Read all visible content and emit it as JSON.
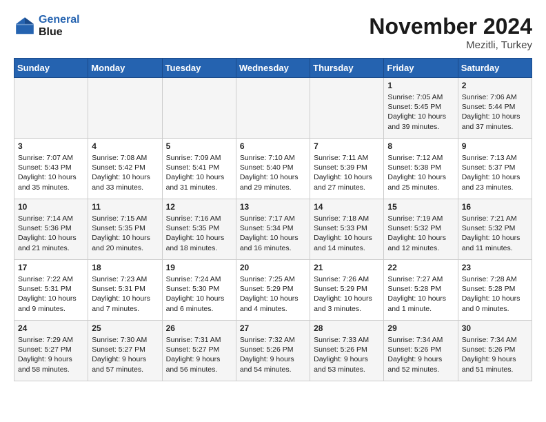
{
  "header": {
    "logo_line1": "General",
    "logo_line2": "Blue",
    "month": "November 2024",
    "location": "Mezitli, Turkey"
  },
  "days_of_week": [
    "Sunday",
    "Monday",
    "Tuesday",
    "Wednesday",
    "Thursday",
    "Friday",
    "Saturday"
  ],
  "weeks": [
    [
      {
        "day": "",
        "info": ""
      },
      {
        "day": "",
        "info": ""
      },
      {
        "day": "",
        "info": ""
      },
      {
        "day": "",
        "info": ""
      },
      {
        "day": "",
        "info": ""
      },
      {
        "day": "1",
        "info": "Sunrise: 7:05 AM\nSunset: 5:45 PM\nDaylight: 10 hours and 39 minutes."
      },
      {
        "day": "2",
        "info": "Sunrise: 7:06 AM\nSunset: 5:44 PM\nDaylight: 10 hours and 37 minutes."
      }
    ],
    [
      {
        "day": "3",
        "info": "Sunrise: 7:07 AM\nSunset: 5:43 PM\nDaylight: 10 hours and 35 minutes."
      },
      {
        "day": "4",
        "info": "Sunrise: 7:08 AM\nSunset: 5:42 PM\nDaylight: 10 hours and 33 minutes."
      },
      {
        "day": "5",
        "info": "Sunrise: 7:09 AM\nSunset: 5:41 PM\nDaylight: 10 hours and 31 minutes."
      },
      {
        "day": "6",
        "info": "Sunrise: 7:10 AM\nSunset: 5:40 PM\nDaylight: 10 hours and 29 minutes."
      },
      {
        "day": "7",
        "info": "Sunrise: 7:11 AM\nSunset: 5:39 PM\nDaylight: 10 hours and 27 minutes."
      },
      {
        "day": "8",
        "info": "Sunrise: 7:12 AM\nSunset: 5:38 PM\nDaylight: 10 hours and 25 minutes."
      },
      {
        "day": "9",
        "info": "Sunrise: 7:13 AM\nSunset: 5:37 PM\nDaylight: 10 hours and 23 minutes."
      }
    ],
    [
      {
        "day": "10",
        "info": "Sunrise: 7:14 AM\nSunset: 5:36 PM\nDaylight: 10 hours and 21 minutes."
      },
      {
        "day": "11",
        "info": "Sunrise: 7:15 AM\nSunset: 5:35 PM\nDaylight: 10 hours and 20 minutes."
      },
      {
        "day": "12",
        "info": "Sunrise: 7:16 AM\nSunset: 5:35 PM\nDaylight: 10 hours and 18 minutes."
      },
      {
        "day": "13",
        "info": "Sunrise: 7:17 AM\nSunset: 5:34 PM\nDaylight: 10 hours and 16 minutes."
      },
      {
        "day": "14",
        "info": "Sunrise: 7:18 AM\nSunset: 5:33 PM\nDaylight: 10 hours and 14 minutes."
      },
      {
        "day": "15",
        "info": "Sunrise: 7:19 AM\nSunset: 5:32 PM\nDaylight: 10 hours and 12 minutes."
      },
      {
        "day": "16",
        "info": "Sunrise: 7:21 AM\nSunset: 5:32 PM\nDaylight: 10 hours and 11 minutes."
      }
    ],
    [
      {
        "day": "17",
        "info": "Sunrise: 7:22 AM\nSunset: 5:31 PM\nDaylight: 10 hours and 9 minutes."
      },
      {
        "day": "18",
        "info": "Sunrise: 7:23 AM\nSunset: 5:31 PM\nDaylight: 10 hours and 7 minutes."
      },
      {
        "day": "19",
        "info": "Sunrise: 7:24 AM\nSunset: 5:30 PM\nDaylight: 10 hours and 6 minutes."
      },
      {
        "day": "20",
        "info": "Sunrise: 7:25 AM\nSunset: 5:29 PM\nDaylight: 10 hours and 4 minutes."
      },
      {
        "day": "21",
        "info": "Sunrise: 7:26 AM\nSunset: 5:29 PM\nDaylight: 10 hours and 3 minutes."
      },
      {
        "day": "22",
        "info": "Sunrise: 7:27 AM\nSunset: 5:28 PM\nDaylight: 10 hours and 1 minute."
      },
      {
        "day": "23",
        "info": "Sunrise: 7:28 AM\nSunset: 5:28 PM\nDaylight: 10 hours and 0 minutes."
      }
    ],
    [
      {
        "day": "24",
        "info": "Sunrise: 7:29 AM\nSunset: 5:27 PM\nDaylight: 9 hours and 58 minutes."
      },
      {
        "day": "25",
        "info": "Sunrise: 7:30 AM\nSunset: 5:27 PM\nDaylight: 9 hours and 57 minutes."
      },
      {
        "day": "26",
        "info": "Sunrise: 7:31 AM\nSunset: 5:27 PM\nDaylight: 9 hours and 56 minutes."
      },
      {
        "day": "27",
        "info": "Sunrise: 7:32 AM\nSunset: 5:26 PM\nDaylight: 9 hours and 54 minutes."
      },
      {
        "day": "28",
        "info": "Sunrise: 7:33 AM\nSunset: 5:26 PM\nDaylight: 9 hours and 53 minutes."
      },
      {
        "day": "29",
        "info": "Sunrise: 7:34 AM\nSunset: 5:26 PM\nDaylight: 9 hours and 52 minutes."
      },
      {
        "day": "30",
        "info": "Sunrise: 7:34 AM\nSunset: 5:26 PM\nDaylight: 9 hours and 51 minutes."
      }
    ]
  ]
}
